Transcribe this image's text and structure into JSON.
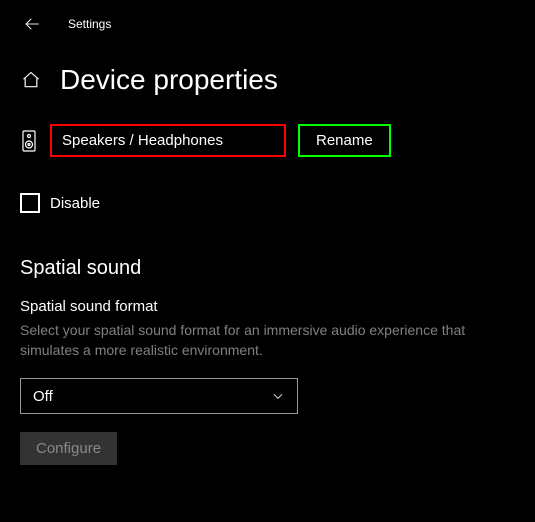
{
  "titlebar": {
    "title": "Settings"
  },
  "page": {
    "title": "Device properties"
  },
  "device": {
    "name": "Speakers / Headphones",
    "rename_label": "Rename",
    "disable_label": "Disable"
  },
  "spatial": {
    "section_title": "Spatial sound",
    "format_label": "Spatial sound format",
    "description": "Select your spatial sound format for an immersive audio experience that simulates a more realistic environment.",
    "selected": "Off",
    "configure_label": "Configure"
  }
}
